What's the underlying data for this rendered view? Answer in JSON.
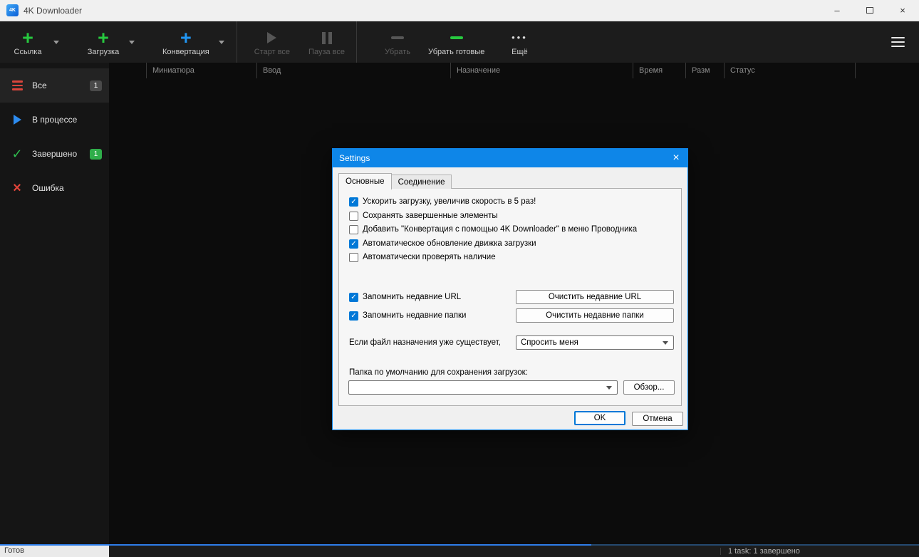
{
  "window": {
    "title": "4K Downloader"
  },
  "toolbar": {
    "link": "Ссылка",
    "download": "Загрузка",
    "convert": "Конвертация",
    "start_all": "Старт все",
    "pause_all": "Пауза все",
    "remove": "Убрать",
    "remove_done": "Убрать готовые",
    "more": "Ещё"
  },
  "sidebar": {
    "items": [
      {
        "label": "Все",
        "badge": "1"
      },
      {
        "label": "В процессе"
      },
      {
        "label": "Завершено",
        "badge": "1"
      },
      {
        "label": "Ошибка"
      }
    ]
  },
  "table": {
    "columns": [
      "Миниатюра",
      "Ввод",
      "Назначение",
      "Время",
      "Разм",
      "Статус"
    ]
  },
  "dialog": {
    "title": "Settings",
    "tabs": [
      "Основные",
      "Соединение"
    ],
    "checkboxes": [
      {
        "label": "Ускорить загрузку, увеличив скорость в 5 раз!",
        "checked": true
      },
      {
        "label": "Сохранять завершенные элементы",
        "checked": false
      },
      {
        "label": "Добавить \"Конвертация с помощью 4K Downloader\" в меню Проводника",
        "checked": false
      },
      {
        "label": "Автоматическое обновление движка загрузки",
        "checked": true
      },
      {
        "label": "Автоматически проверять наличие",
        "checked": false
      }
    ],
    "recent": [
      {
        "label": "Запомнить недавние URL",
        "checked": true,
        "button": "Очистить недавние URL"
      },
      {
        "label": "Запомнить недавние папки",
        "checked": true,
        "button": "Очистить недавние папки"
      }
    ],
    "exists_label": "Если файл назначения уже существует,",
    "exists_value": "Спросить меня",
    "folder_label": "Папка по умолчанию для сохранения загрузок:",
    "folder_value": "",
    "browse": "Обзор...",
    "ok": "OK",
    "cancel": "Отмена"
  },
  "statusbar": {
    "left": "Готов",
    "right": "1 task: 1 завершено"
  },
  "colors": {
    "accent_blue": "#0e86e8",
    "check_blue": "#0078d7",
    "green": "#27c93f",
    "red": "#e0443a"
  }
}
